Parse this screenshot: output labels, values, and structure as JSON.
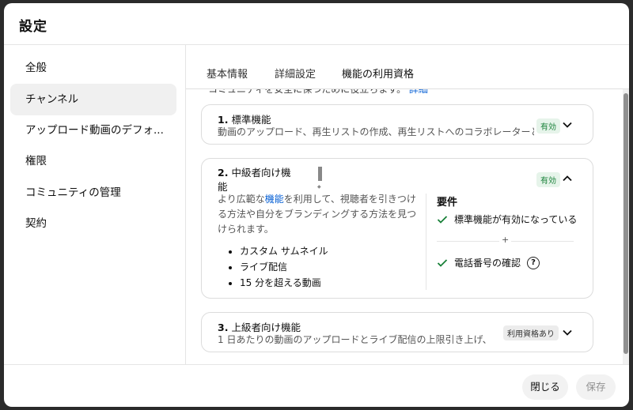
{
  "dialog": {
    "title": "設定"
  },
  "sidebar": {
    "items": [
      {
        "label": "全般"
      },
      {
        "label": "チャンネル"
      },
      {
        "label": "アップロード動画のデフォ..."
      },
      {
        "label": "権限"
      },
      {
        "label": "コミュニティの管理"
      },
      {
        "label": "契約"
      }
    ],
    "active_index": 1
  },
  "tabs": [
    {
      "label": "基本情報"
    },
    {
      "label": "詳細設定"
    },
    {
      "label": "機能の利用資格"
    }
  ],
  "active_tab": 2,
  "cutoff_text": {
    "text": "コミュニティを安全に保つために役立ちます。",
    "link": "詳細"
  },
  "cards": {
    "standard": {
      "number": "1.",
      "title": "標準機能",
      "desc": "動画のアップロード、再生リストの作成、再生リストへのコラボレーターと...",
      "badge": "有効",
      "chevron": "chevron-down-icon"
    },
    "intermediate": {
      "number": "2.",
      "title_line1": "中級者向け機",
      "title_line2": "能",
      "badge": "有効",
      "chevron": "chevron-up-icon",
      "intro_pre": "より広範な",
      "intro_link": "機能",
      "intro_post": "を利用して、視聴者を引きつける方法や自分をブランディングする方法を見つけられます。",
      "features": [
        "カスタム サムネイル",
        "ライブ配信",
        "15 分を超える動画"
      ],
      "requirements_title": "要件",
      "requirements": [
        "標準機能が有効になっている",
        "電話番号の確認"
      ],
      "plus": "+"
    },
    "advanced": {
      "number": "3.",
      "title": "上級者向け機能",
      "desc": "1 日あたりの動画のアップロードとライブ配信の上限引き上げ、収...",
      "badge": "利用資格あり",
      "chevron": "chevron-down-icon"
    }
  },
  "footer": {
    "close_label": "閉じる",
    "save_label": "保存"
  },
  "colors": {
    "accent_link": "#065fd4",
    "badge_green_bg": "#e6f4ea",
    "badge_green_text": "#188038",
    "check_green": "#188038"
  }
}
